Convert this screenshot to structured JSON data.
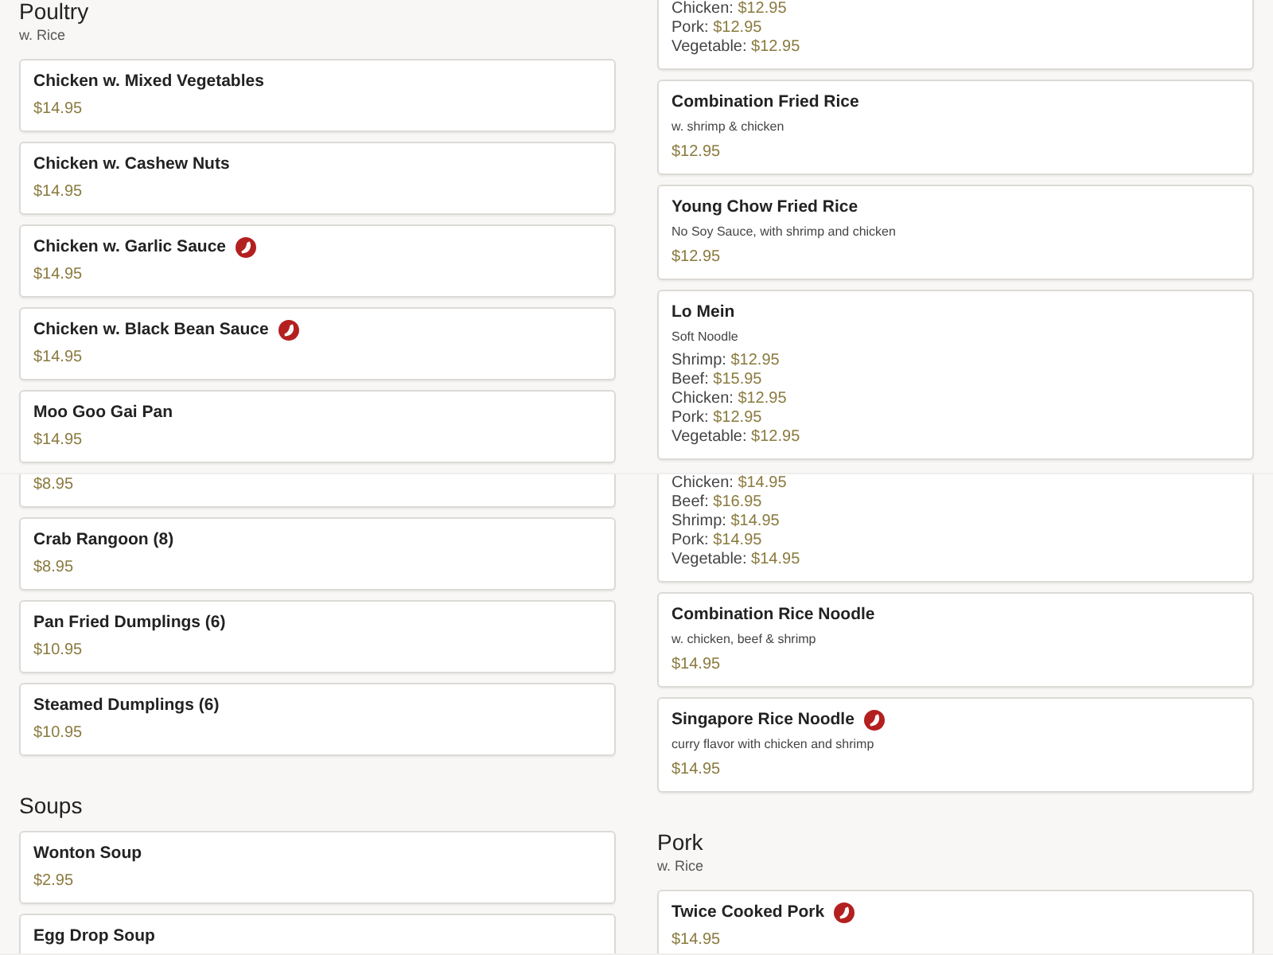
{
  "panels": [
    {
      "columns": [
        [
          {
            "kind": "heading",
            "title": "Poultry",
            "subtitle": "w. Rice"
          },
          {
            "kind": "card",
            "name": "Chicken w. Mixed Vegetables",
            "spicy": false,
            "price": "$14.95"
          },
          {
            "kind": "card",
            "name": "Chicken w. Cashew Nuts",
            "spicy": false,
            "price": "$14.95"
          },
          {
            "kind": "card",
            "name": "Chicken w. Garlic Sauce",
            "spicy": true,
            "price": "$14.95"
          },
          {
            "kind": "card",
            "name": "Chicken w. Black Bean Sauce",
            "spicy": true,
            "price": "$14.95"
          },
          {
            "kind": "card",
            "name": "Moo Goo Gai Pan",
            "spicy": false,
            "price": "$14.95"
          }
        ],
        [
          {
            "kind": "card",
            "clipped_top": true,
            "prices": [
              {
                "label": "Chicken:",
                "price": "$12.95"
              },
              {
                "label": "Pork:",
                "price": "$12.95"
              },
              {
                "label": "Vegetable:",
                "price": "$12.95"
              }
            ]
          },
          {
            "kind": "card",
            "name": "Combination Fried Rice",
            "spicy": false,
            "description": "w. shrimp & chicken",
            "price": "$12.95"
          },
          {
            "kind": "card",
            "name": "Young Chow Fried Rice",
            "spicy": false,
            "description": "No Soy Sauce, with shrimp and chicken",
            "price": "$12.95"
          },
          {
            "kind": "card",
            "name": "Lo Mein",
            "spicy": false,
            "description": "Soft Noodle",
            "prices": [
              {
                "label": "Shrimp:",
                "price": "$12.95"
              },
              {
                "label": "Beef:",
                "price": "$15.95"
              },
              {
                "label": "Chicken:",
                "price": "$12.95"
              },
              {
                "label": "Pork:",
                "price": "$12.95"
              },
              {
                "label": "Vegetable:",
                "price": "$12.95"
              }
            ]
          }
        ]
      ]
    },
    {
      "columns": [
        [
          {
            "kind": "card",
            "clipped_top": true,
            "price": "$8.95"
          },
          {
            "kind": "card",
            "name": "Crab Rangoon (8)",
            "spicy": false,
            "price": "$8.95"
          },
          {
            "kind": "card",
            "name": "Pan Fried Dumplings (6)",
            "spicy": false,
            "price": "$10.95"
          },
          {
            "kind": "card",
            "name": "Steamed Dumplings (6)",
            "spicy": false,
            "price": "$10.95"
          },
          {
            "kind": "heading",
            "title": "Soups"
          },
          {
            "kind": "card",
            "name": "Wonton Soup",
            "spicy": false,
            "price": "$2.95"
          },
          {
            "kind": "card",
            "name": "Egg Drop Soup",
            "spicy": false
          }
        ],
        [
          {
            "kind": "card",
            "clipped_top": true,
            "prices": [
              {
                "label": "Chicken:",
                "price": "$14.95"
              },
              {
                "label": "Beef:",
                "price": "$16.95"
              },
              {
                "label": "Shrimp:",
                "price": "$14.95"
              },
              {
                "label": "Pork:",
                "price": "$14.95"
              },
              {
                "label": "Vegetable:",
                "price": "$14.95"
              }
            ]
          },
          {
            "kind": "card",
            "name": "Combination Rice Noodle",
            "spicy": false,
            "description": "w. chicken, beef & shrimp",
            "price": "$14.95"
          },
          {
            "kind": "card",
            "name": "Singapore Rice Noodle",
            "spicy": true,
            "description": "curry flavor with chicken and shrimp",
            "price": "$14.95"
          },
          {
            "kind": "heading",
            "title": "Pork",
            "subtitle": "w. Rice"
          },
          {
            "kind": "card",
            "name": "Twice Cooked Pork",
            "spicy": true,
            "price": "$14.95"
          }
        ]
      ]
    }
  ]
}
